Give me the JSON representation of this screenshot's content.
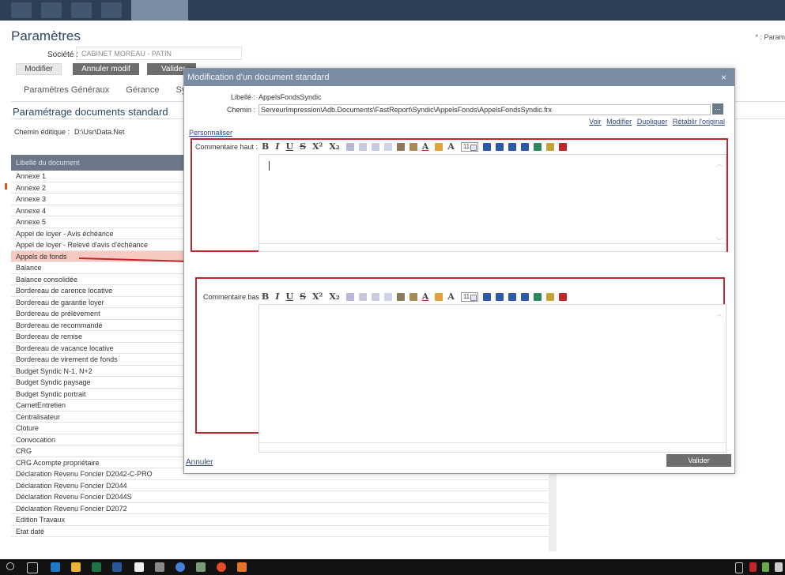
{
  "header": {
    "title": "Paramètres",
    "legend": "* : Param"
  },
  "societe": {
    "label": "Société :",
    "value": "CABINET MOREAU - PATIN"
  },
  "actions": {
    "modifier": "Modifier",
    "annuler_modif": "Annuler modif",
    "valider": "Valider"
  },
  "tabs": [
    "Paramètres Généraux",
    "Gérance",
    "Syndic"
  ],
  "section": {
    "title": "Paramétrage documents standard"
  },
  "chemin_editique": {
    "label": "Chemin éditique :",
    "value": "D:\\Usr\\Data.Net"
  },
  "doclist": {
    "header": "Libellé du document",
    "rows": [
      "Annexe 1",
      "Annexe 2",
      "Annexe 3",
      "Annexe 4",
      "Annexe 5",
      "Appel de loyer - Avis échéance",
      "Appel de loyer - Relevé d'avis d'échéance",
      "Appels de fonds",
      "Balance",
      "Balance consolidée",
      "Bordereau de carence locative",
      "Bordereau de garantie loyer",
      "Bordereau de prélèvement",
      "Bordereau de recommandé",
      "Bordereau de remise",
      "Bordereau de vacance locative",
      "Bordereau de virement de fonds",
      "Budget Syndic N-1, N+2",
      "Budget Syndic paysage",
      "Budget Syndic portrait",
      "CarnetEntretien",
      "Centralisateur",
      "Cloture",
      "Convocation",
      "CRG",
      "CRG Acompte propriétaire",
      "Déclaration Revenu Foncier D2042-C-PRO",
      "Déclaration Revenu Foncier D2044",
      "Déclaration Revenu Foncier D2044S",
      "Déclaration Revenu Foncier D2072",
      "Edition Travaux",
      "Etat daté"
    ],
    "highlighted": "Appels de fonds"
  },
  "modal": {
    "title": "Modification d'un document standard",
    "close": "×",
    "libelle_label": "Libellé :",
    "libelle_value": "AppelsFondsSyndic",
    "chemin_label": "Chemin :",
    "chemin_value": "ServeurImpression\\Adb.Documents\\FastReport\\Syndic\\AppelsFonds\\AppelsFondsSyndic.frx",
    "browse": "...",
    "links": [
      "Voir",
      "Modifier",
      "Dupliquer",
      "Rétablir l'original"
    ],
    "personnaliser": "Personnaliser",
    "commentaire_haut": "Commentaire haut :",
    "commentaire_bas": "Commentaire bas :",
    "font_size": "11",
    "annuler": "Annuler",
    "valider": "Valider"
  },
  "toolbar": {
    "bold": "B",
    "italic": "I",
    "underline": "U",
    "strike": "S",
    "superscript": "X²",
    "subscript": "X₂",
    "font_color": "A",
    "font": "A",
    "icons": [
      "undo-icon",
      "redo-icon",
      "cut-icon",
      "copy-icon",
      "paste-icon",
      "paste-word-icon",
      "text-color-icon",
      "highlight-icon",
      "font-icon",
      "bullet-list-icon",
      "numbered-list-icon",
      "outdent-icon",
      "indent-icon",
      "link-icon",
      "image-icon",
      "delete-icon"
    ]
  },
  "colors": {
    "header": "#2d3f56",
    "modal_head": "#7a8ca3",
    "highlight": "#f7c9c0",
    "annotation": "#c0272d"
  }
}
